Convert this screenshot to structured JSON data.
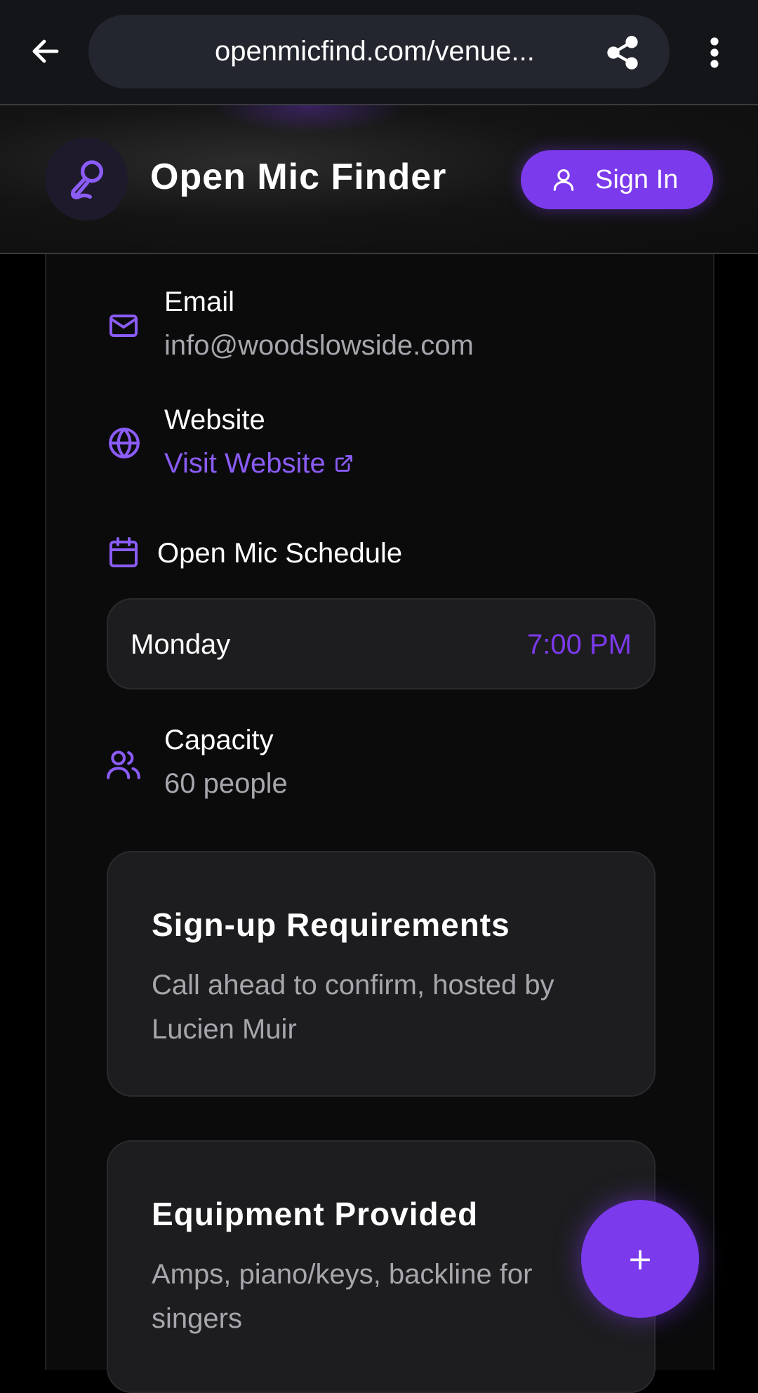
{
  "browser": {
    "url": "openmicfind.com/venue..."
  },
  "header": {
    "brand": "Open Mic Finder",
    "signin_label": "Sign In"
  },
  "contact": {
    "email_label": "Email",
    "email_value": "info@woodslowside.com",
    "website_label": "Website",
    "website_link": "Visit Website"
  },
  "schedule": {
    "title": "Open Mic Schedule",
    "entries": [
      {
        "day": "Monday",
        "time": "7:00 PM"
      }
    ]
  },
  "capacity": {
    "label": "Capacity",
    "value": "60 people"
  },
  "signup": {
    "title": "Sign-up Requirements",
    "text": "Call ahead to confirm, hosted by Lucien Muir"
  },
  "equipment": {
    "title": "Equipment Provided",
    "text": "Amps, piano/keys, backline for singers"
  },
  "fab": {
    "label": "+"
  },
  "colors": {
    "accent": "#7c3aed",
    "accent_text": "#8b5cf6",
    "background": "#000000",
    "card": "#1d1d1f",
    "muted_text": "#a6a6ad"
  },
  "icons": {
    "back": "arrow-left-icon",
    "share": "share-icon",
    "menu": "more-vertical-icon",
    "logo": "microphone-icon",
    "signin": "user-icon",
    "email": "mail-icon",
    "website": "globe-icon",
    "external": "external-link-icon",
    "schedule": "calendar-icon",
    "capacity": "users-icon",
    "fab": "plus-icon"
  }
}
